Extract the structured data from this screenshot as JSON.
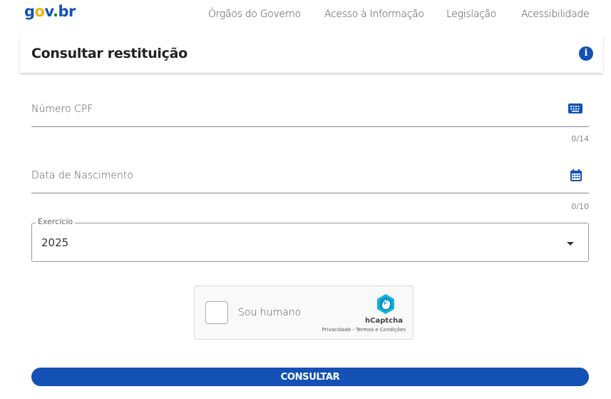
{
  "header": {
    "logo": {
      "g": "g",
      "o": "o",
      "v": "v",
      "dot": ".",
      "br": "br"
    },
    "nav": [
      "Órgãos do Governo",
      "Acesso à Informação",
      "Legislação",
      "Acessibilidade"
    ]
  },
  "page": {
    "title": "Consultar restituição",
    "info_glyph": "i"
  },
  "form": {
    "cpf": {
      "label": "Número CPF",
      "counter": "0/14",
      "icon": "keyboard-icon"
    },
    "birth": {
      "label": "Data de Nascimento",
      "counter": "0/10",
      "icon": "calendar-icon"
    },
    "exercise": {
      "legend": "Exercício",
      "value": "2025"
    }
  },
  "captcha": {
    "label": "Sou humano",
    "brand": "hCaptcha",
    "terms": "Privacidade - Termos e Condições"
  },
  "submit": {
    "label": "CONSULTAR"
  },
  "colors": {
    "primary": "#1351b4",
    "logo_yellow": "#f0b400",
    "logo_green": "#168821",
    "captcha_logo": "#0fb6d8"
  }
}
